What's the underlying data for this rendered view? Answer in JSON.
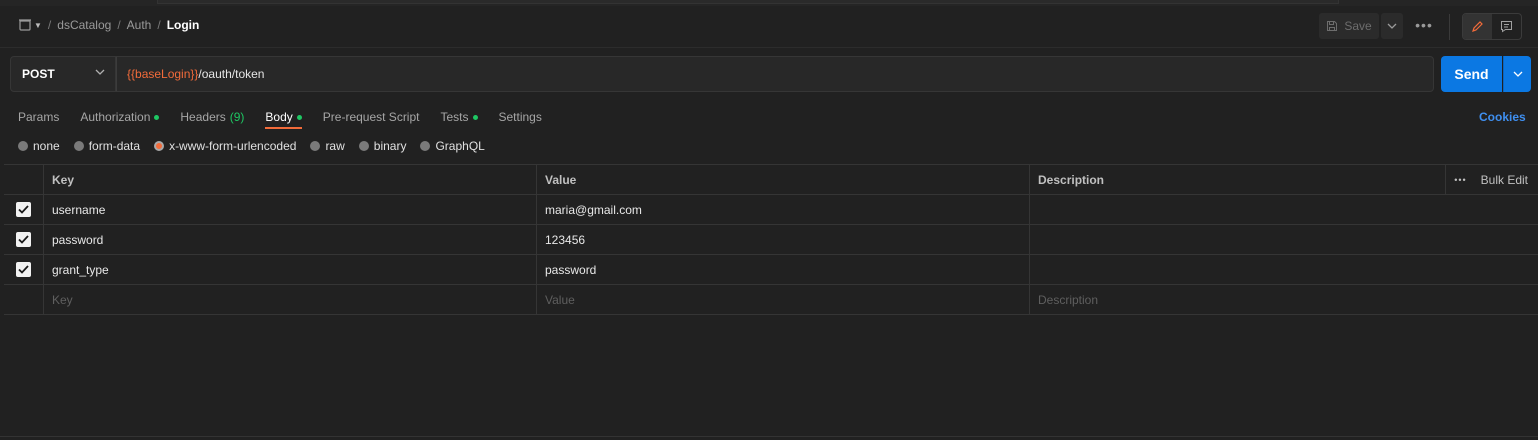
{
  "breadcrumb": {
    "collection": "dsCatalog",
    "folder": "Auth",
    "request": "Login",
    "sep": "/"
  },
  "toolbar": {
    "save_label": "Save",
    "more_label": "•••"
  },
  "request": {
    "method": "POST",
    "url_variable": "{{baseLogin}}",
    "url_path": "/oauth/token",
    "send_label": "Send"
  },
  "tabs": [
    {
      "label": "Params",
      "dot": false,
      "count": ""
    },
    {
      "label": "Authorization",
      "dot": true,
      "count": ""
    },
    {
      "label": "Headers",
      "dot": false,
      "count": "(9)"
    },
    {
      "label": "Body",
      "dot": true,
      "count": "",
      "active": true
    },
    {
      "label": "Pre-request Script",
      "dot": false,
      "count": ""
    },
    {
      "label": "Tests",
      "dot": true,
      "count": ""
    },
    {
      "label": "Settings",
      "dot": false,
      "count": ""
    }
  ],
  "cookies_label": "Cookies",
  "body_types": [
    {
      "label": "none",
      "selected": false
    },
    {
      "label": "form-data",
      "selected": false
    },
    {
      "label": "x-www-form-urlencoded",
      "selected": true
    },
    {
      "label": "raw",
      "selected": false
    },
    {
      "label": "binary",
      "selected": false
    },
    {
      "label": "GraphQL",
      "selected": false
    }
  ],
  "table": {
    "columns": {
      "key": "Key",
      "value": "Value",
      "description": "Description",
      "more": "•••",
      "bulk_edit": "Bulk Edit"
    },
    "rows": [
      {
        "checked": true,
        "key": "username",
        "value": "maria@gmail.com",
        "description": ""
      },
      {
        "checked": true,
        "key": "password",
        "value": "123456",
        "description": ""
      },
      {
        "checked": true,
        "key": "grant_type",
        "value": "password",
        "description": ""
      }
    ],
    "placeholders": {
      "key": "Key",
      "value": "Value",
      "description": "Description"
    }
  },
  "colors": {
    "accent": "#f26b3a",
    "primary": "#0b78e3",
    "ok": "#1ec763",
    "background": "#212121"
  }
}
